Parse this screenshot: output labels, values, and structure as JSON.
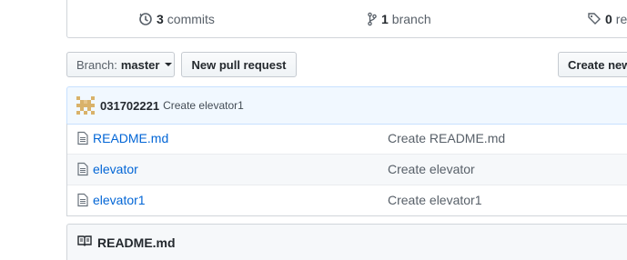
{
  "stats": {
    "commits": {
      "count": "3",
      "label": "commits",
      "icon": "history-icon"
    },
    "branches": {
      "count": "1",
      "label": "branch",
      "icon": "git-branch-icon"
    },
    "releases": {
      "count": "0",
      "label": "re",
      "icon": "tag-icon"
    }
  },
  "branch_selector": {
    "label": "Branch:",
    "value": "master"
  },
  "new_pull_request": "New pull request",
  "create_new_file": "Create new",
  "latest_commit": {
    "author": "031702221",
    "message": "Create elevator1"
  },
  "files": [
    {
      "name": "README.md",
      "message": "Create README.md",
      "icon": "file-icon"
    },
    {
      "name": "elevator",
      "message": "Create elevator",
      "icon": "file-icon"
    },
    {
      "name": "elevator1",
      "message": "Create elevator1",
      "icon": "file-icon"
    }
  ],
  "readme": {
    "title": "README.md",
    "icon": "book-icon"
  },
  "colors": {
    "link": "#0366d6",
    "commit_bg": "#f1f8ff",
    "border": "#d1d5da",
    "alt_row": "#f6f8fa"
  }
}
